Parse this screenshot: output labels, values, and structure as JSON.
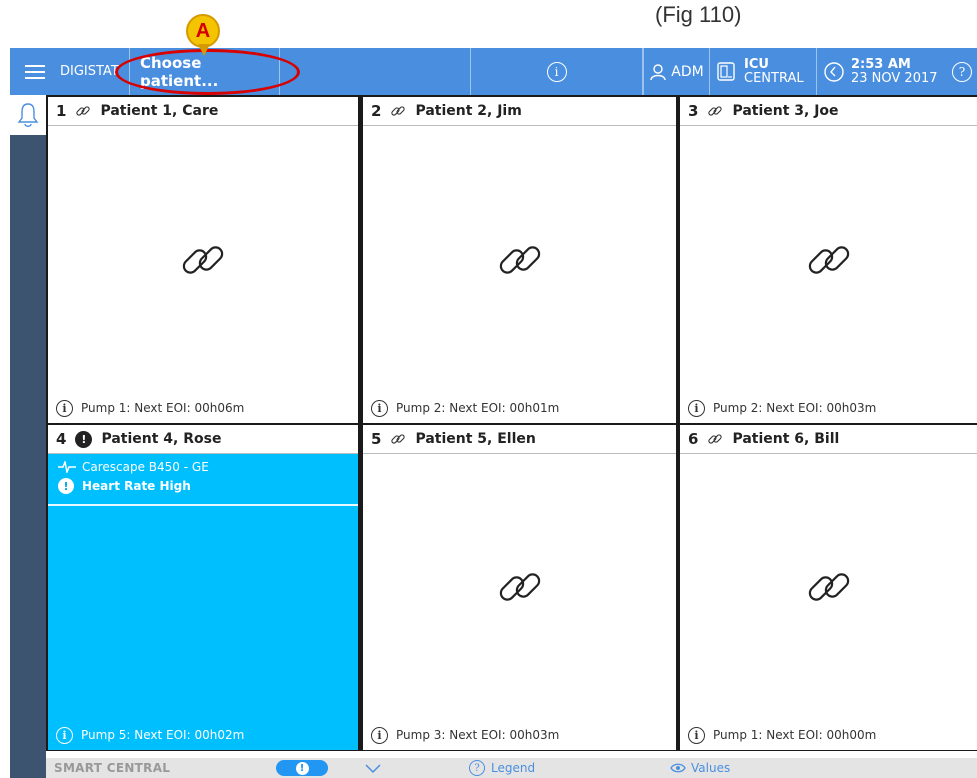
{
  "annotation": {
    "top_note": "(Fig 110)",
    "marker": "A"
  },
  "header": {
    "brand": "DIGISTAT",
    "choose_patient": "Choose patient...",
    "user": "ADM",
    "ward_title": "ICU",
    "ward_sub": "CENTRAL",
    "time": "2:53 AM",
    "date": "23 NOV 2017"
  },
  "tiles": [
    {
      "num": "1",
      "name": "Patient 1, Care",
      "footer": "Pump 1: Next EOI: 00h06m",
      "alarm": false
    },
    {
      "num": "2",
      "name": "Patient 2, Jim",
      "footer": "Pump 2: Next EOI: 00h01m",
      "alarm": false
    },
    {
      "num": "3",
      "name": "Patient 3, Joe",
      "footer": "Pump 2: Next EOI: 00h03m",
      "alarm": false
    },
    {
      "num": "4",
      "name": "Patient 4, Rose",
      "footer": "Pump 5: Next EOI: 00h02m",
      "alarm": true,
      "device": "Carescape B450 - GE",
      "alarm_text": "Heart Rate High"
    },
    {
      "num": "5",
      "name": "Patient 5, Ellen",
      "footer": "Pump 3: Next EOI: 00h03m",
      "alarm": false
    },
    {
      "num": "6",
      "name": "Patient 6, Bill",
      "footer": "Pump 1: Next EOI: 00h00m",
      "alarm": false
    }
  ],
  "footer": {
    "title": "SMART CENTRAL",
    "legend": "Legend",
    "values": "Values"
  },
  "colors": {
    "header": "#4a8fdf",
    "alarm": "#00bfff",
    "sidebar": "#3d5470"
  }
}
